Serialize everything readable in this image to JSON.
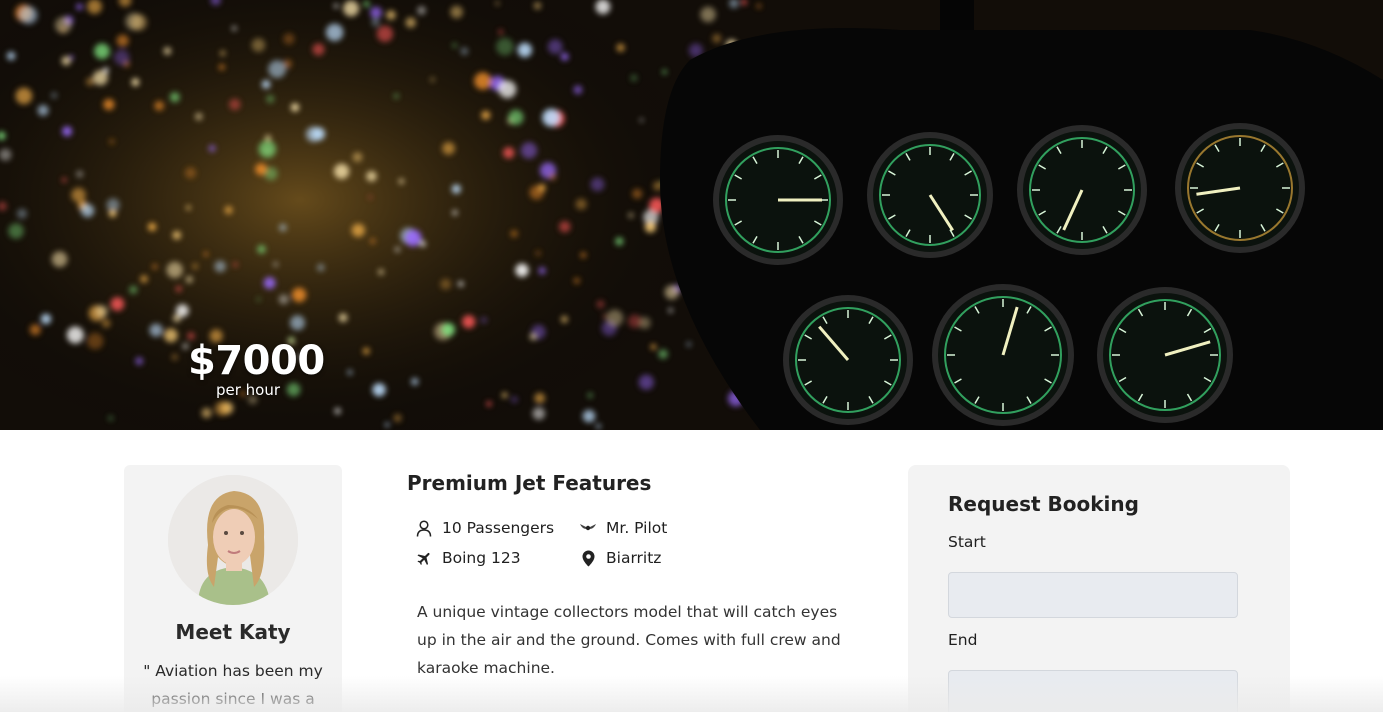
{
  "hero": {
    "price": "$7000",
    "price_unit": "per hour"
  },
  "profile": {
    "name": "Meet Katy",
    "quote": "\" Aviation has been my passion since I was a"
  },
  "features": {
    "title": "Premium Jet Features",
    "items": [
      {
        "icon": "person-icon",
        "label": "10 Passengers"
      },
      {
        "icon": "pilot-wings-icon",
        "label": "Mr. Pilot"
      },
      {
        "icon": "airplane-icon",
        "label": "Boing 123"
      },
      {
        "icon": "map-pin-icon",
        "label": "Biarritz"
      }
    ],
    "description": "A unique vintage collectors model that will catch eyes up in the air and the ground. Comes with full crew and karaoke machine."
  },
  "booking": {
    "title": "Request Booking",
    "start_label": "Start",
    "start_value": "",
    "end_label": "End",
    "end_value": ""
  }
}
